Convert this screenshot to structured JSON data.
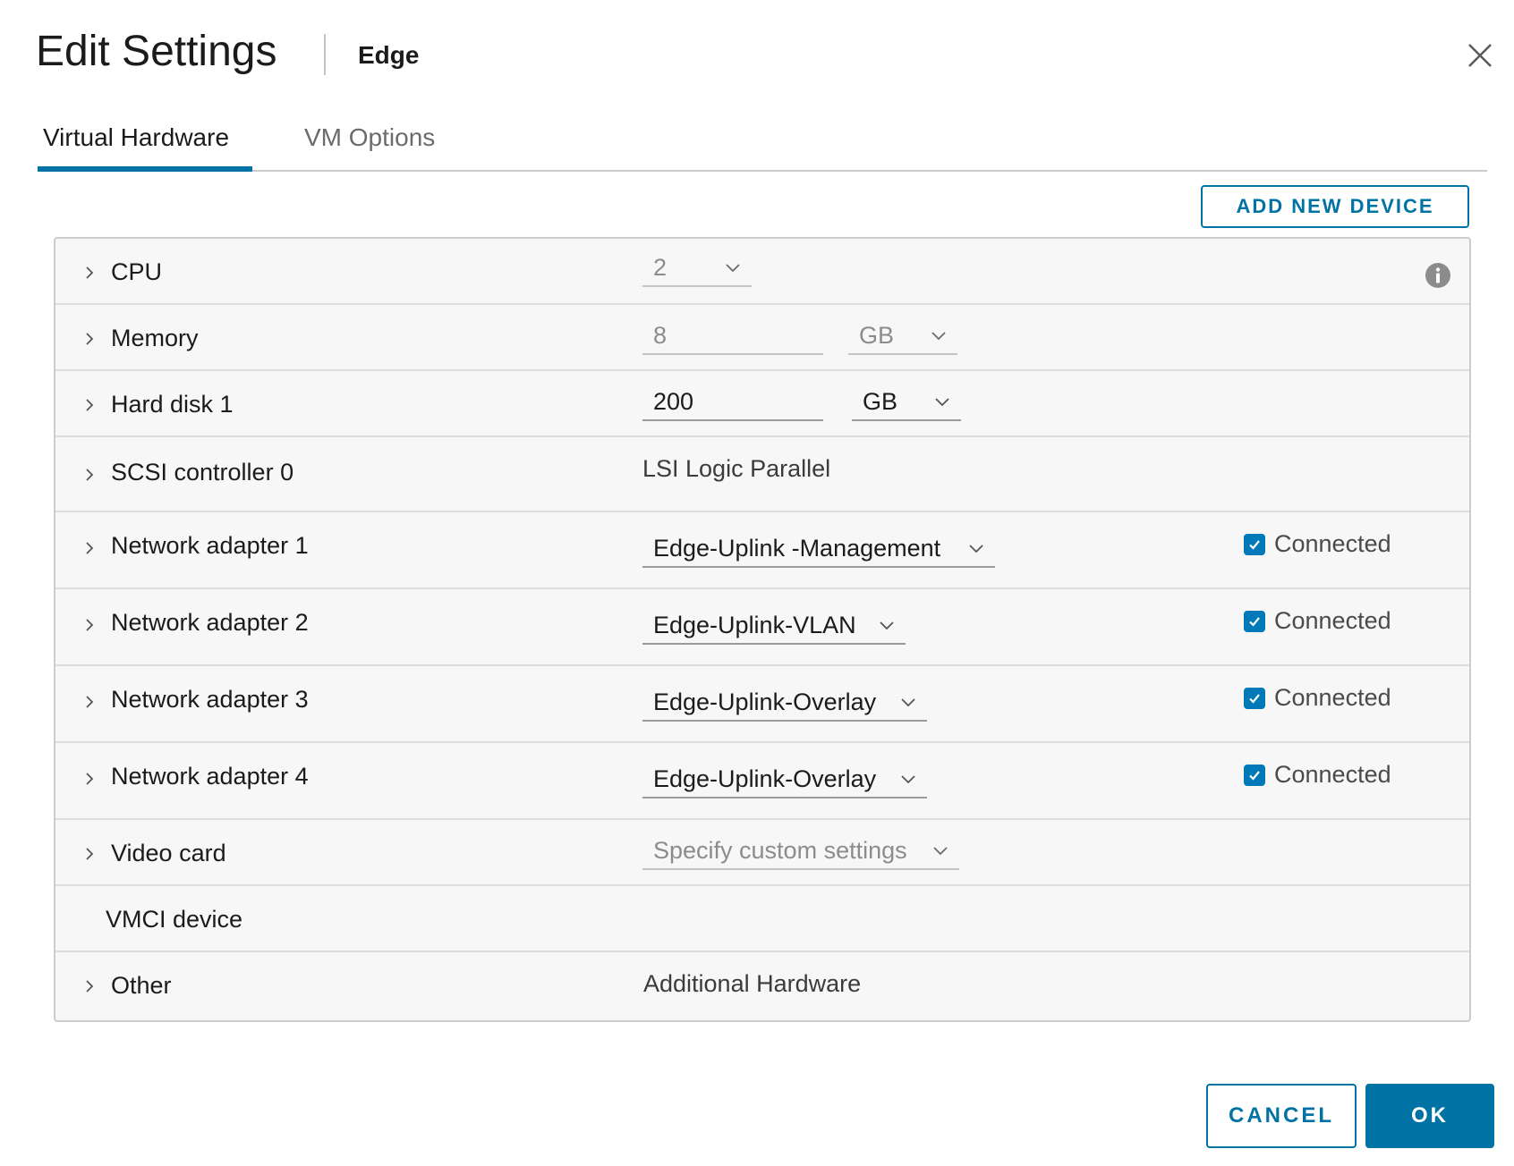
{
  "dialog": {
    "title": "Edit Settings",
    "subtitle": "Edge",
    "close_icon": "close-icon"
  },
  "tabs": [
    {
      "label": "Virtual Hardware",
      "active": true
    },
    {
      "label": "VM Options",
      "active": false
    }
  ],
  "toolbar": {
    "add_device_label": "ADD NEW DEVICE"
  },
  "hardware": {
    "cpu": {
      "label": "CPU",
      "value": "2"
    },
    "memory": {
      "label": "Memory",
      "value": "8",
      "unit": "GB"
    },
    "hard_disk": {
      "label": "Hard disk 1",
      "value": "200",
      "unit": "GB"
    },
    "scsi": {
      "label": "SCSI controller 0",
      "value": "LSI Logic Parallel"
    },
    "network_adapters": [
      {
        "label": "Network adapter 1",
        "network": "Edge-Uplink -Management",
        "connected": true,
        "connected_label": "Connected"
      },
      {
        "label": "Network adapter 2",
        "network": "Edge-Uplink-VLAN",
        "connected": true,
        "connected_label": "Connected"
      },
      {
        "label": "Network adapter 3",
        "network": "Edge-Uplink-Overlay",
        "connected": true,
        "connected_label": "Connected"
      },
      {
        "label": "Network adapter 4",
        "network": "Edge-Uplink-Overlay",
        "connected": true,
        "connected_label": "Connected"
      }
    ],
    "video_card": {
      "label": "Video card",
      "value": "Specify custom settings"
    },
    "vmci": {
      "label": "VMCI device"
    },
    "other": {
      "label": "Other",
      "value": "Additional Hardware"
    }
  },
  "footer": {
    "cancel_label": "CANCEL",
    "ok_label": "OK"
  },
  "colors": {
    "accent": "#0072a3",
    "checkbox": "#0079b8"
  }
}
